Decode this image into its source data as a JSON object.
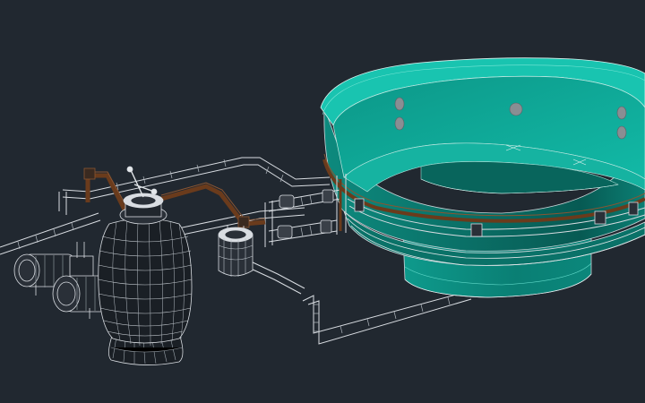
{
  "viewport": {
    "background": "#212830"
  },
  "colors": {
    "wire": "#d9dde2",
    "wire_dim": "#9aa3ab",
    "tub_rim": "#19c4b0",
    "tub_inner": "#0fa898",
    "tub_wall": "#0b7f74",
    "tub_dark": "#075a53",
    "tub_base": "#0c8e82",
    "brown_pipe": "#6a3b1c",
    "brown_pipe_light": "#8a5532",
    "jet": "#8a8e93",
    "equipment_dark": "#1a1f25"
  },
  "components": [
    {
      "name": "hot-tub",
      "icon": "hot-tub-icon"
    },
    {
      "name": "sand-filter",
      "icon": "sand-filter-icon"
    },
    {
      "name": "circulation-pump",
      "icon": "pump-icon"
    },
    {
      "name": "heater-canister",
      "icon": "canister-icon"
    },
    {
      "name": "plumbing",
      "icon": "pipe-icon"
    }
  ]
}
